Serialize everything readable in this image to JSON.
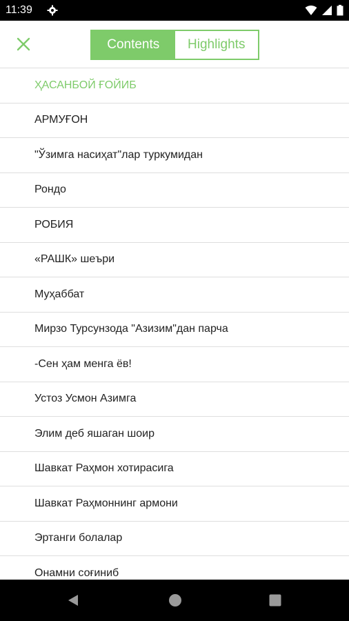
{
  "status_bar": {
    "time": "11:39",
    "icons": [
      "gear-icon",
      "wifi-icon",
      "signal-icon",
      "battery-icon"
    ]
  },
  "header": {
    "close_icon": "close-icon",
    "tabs": [
      {
        "label": "Contents",
        "selected": true
      },
      {
        "label": "Highlights",
        "selected": false
      }
    ]
  },
  "colors": {
    "accent": "#7ecb6a",
    "text": "#222222",
    "divider": "#dedede"
  },
  "toc": {
    "items": [
      {
        "label": "ҲАСАНБОЙ ҒОЙИБ",
        "current": true
      },
      {
        "label": "АРМУҒОН"
      },
      {
        "label": "\"Ўзимга насиҳат\"лар туркумидан"
      },
      {
        "label": "Рондо"
      },
      {
        "label": "РОБИЯ"
      },
      {
        "label": "«РАШК» шеъри"
      },
      {
        "label": "Муҳаббат"
      },
      {
        "label": "Мирзо Турсунзода \"Азизим\"дан парча"
      },
      {
        "label": "-Сен ҳам менга ёв!"
      },
      {
        "label": "Устоз Усмон Азимга"
      },
      {
        "label": "Элим деб яшаган шоир"
      },
      {
        "label": "Шавкат Раҳмон хотирасига"
      },
      {
        "label": "Шавкат Раҳмоннинг армони"
      },
      {
        "label": "Эртанги болалар"
      },
      {
        "label": "Онамни соғиниб"
      }
    ]
  },
  "nav_bar": {
    "buttons": [
      "back-icon",
      "home-icon",
      "recents-icon"
    ]
  }
}
